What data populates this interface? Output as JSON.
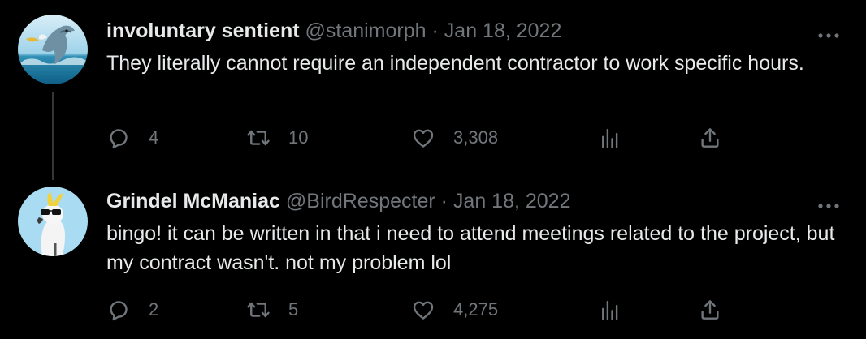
{
  "colors": {
    "background": "#000000",
    "primary_text": "#e7e9ea",
    "secondary_text": "#71767b",
    "thread_line": "#333639"
  },
  "tweets": [
    {
      "display_name": "involuntary sentient",
      "handle": "@stanimorph",
      "separator": "·",
      "date": "Jan 18, 2022",
      "text": "They literally cannot require an independent contractor to work specific hours.",
      "avatar": "dolphin-avatar",
      "replies": "4",
      "retweets": "10",
      "likes": "3,308"
    },
    {
      "display_name": "Grindel McManiac",
      "handle": "@BirdRespecter",
      "separator": "·",
      "date": "Jan 18, 2022",
      "text": "bingo! it can be written in that i need to attend meetings related to the project, but my contract wasn't. not my problem lol",
      "avatar": "cockatoo-avatar",
      "replies": "2",
      "retweets": "5",
      "likes": "4,275"
    }
  ]
}
